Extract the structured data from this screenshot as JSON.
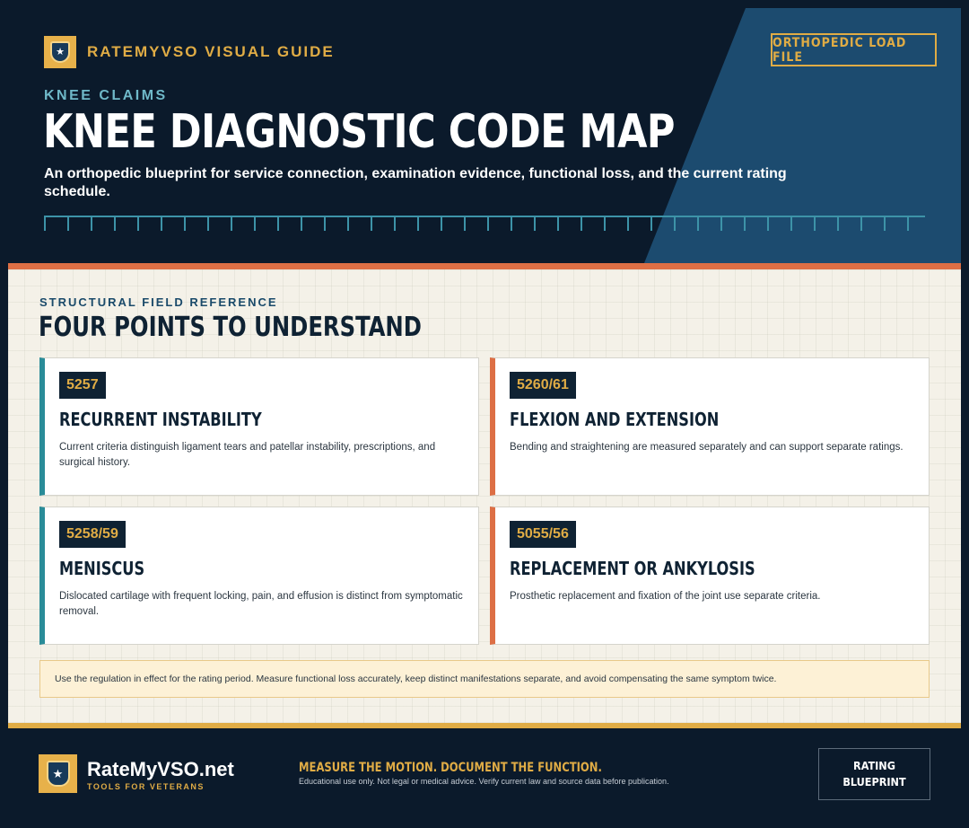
{
  "header": {
    "brand": "RATEMYVSO VISUAL GUIDE",
    "badge": "ORTHOPEDIC LOAD FILE",
    "eyebrow": "KNEE CLAIMS",
    "title": "KNEE DIAGNOSTIC CODE MAP",
    "subtitle": "An orthopedic blueprint for service connection, examination evidence, functional loss, and the current rating schedule."
  },
  "section": {
    "eyebrow": "STRUCTURAL FIELD REFERENCE",
    "title": "FOUR POINTS TO UNDERSTAND"
  },
  "cards": [
    {
      "code": "5257",
      "title": "RECURRENT INSTABILITY",
      "body": "Current criteria distinguish ligament tears and patellar instability, prescriptions, and surgical history."
    },
    {
      "code": "5260/61",
      "title": "FLEXION AND EXTENSION",
      "body": "Bending and straightening are measured separately and can support separate ratings."
    },
    {
      "code": "5258/59",
      "title": "MENISCUS",
      "body": "Dislocated cartilage with frequent locking, pain, and effusion is distinct from symptomatic removal."
    },
    {
      "code": "5055/56",
      "title": "REPLACEMENT OR ANKYLOSIS",
      "body": "Prosthetic replacement and fixation of the joint use separate criteria."
    }
  ],
  "note": "Use the regulation in effect for the rating period. Measure functional loss accurately, keep distinct manifestations separate, and avoid compensating the same symptom twice.",
  "footer": {
    "brand": "RateMyVSO.net",
    "tagline": "TOOLS FOR VETERANS",
    "motto": "MEASURE THE MOTION. DOCUMENT THE FUNCTION.",
    "disclaimer": "Educational use only. Not legal or medical advice. Verify current law and source data before publication.",
    "badge_line1": "RATING",
    "badge_line2": "BLUEPRINT"
  },
  "colors": {
    "navy": "#0b1a2b",
    "blue_panel": "#1c4b6f",
    "gold": "#e0ac45",
    "orange": "#dd6f45",
    "teal": "#2a8c98",
    "paper": "#f4f1e8"
  },
  "icons": {
    "brand_logo": "shield-star-icon",
    "footer_logo": "shield-star-icon"
  }
}
